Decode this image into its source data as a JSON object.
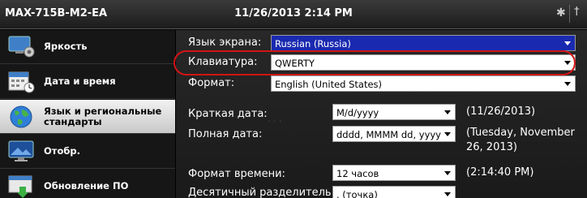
{
  "titlebar": {
    "device": "MAX-715B-M2-EA",
    "datetime": "11/26/2013 2:14 PM"
  },
  "sidebar": {
    "items": [
      {
        "label": "Яркость",
        "icon": "brightness-icon"
      },
      {
        "label": "Дата и время",
        "icon": "calendar-clock-icon"
      },
      {
        "label": "Язык и региональные стандарты",
        "icon": "globe-icon",
        "selected": true
      },
      {
        "label": "Отобр.",
        "icon": "display-icon"
      },
      {
        "label": "Обновление ПО",
        "icon": "software-update-icon"
      }
    ]
  },
  "settings": {
    "display_language": {
      "label": "Язык экрана:",
      "value": "Russian (Russia)"
    },
    "keyboard": {
      "label": "Клавиатура:",
      "value": "QWERTY"
    },
    "format": {
      "label": "Формат:",
      "value": "English (United States)"
    },
    "short_date": {
      "label": "Краткая дата:",
      "value": "M/d/yyyy",
      "preview": "(11/26/2013)"
    },
    "long_date": {
      "label": "Полная дата:",
      "value": "dddd, MMMM dd, yyyy",
      "preview_line1": "(Tuesday, November",
      "preview_line2": "26, 2013)"
    },
    "time_format": {
      "label": "Формат времени:",
      "value": "12 часов",
      "preview": "(2:14:40 PM)"
    },
    "decimal_separator": {
      "label": "Десятичный разделитель:",
      "value": ". (точка)"
    }
  },
  "colors": {
    "highlight": "#1a2ab0",
    "ring": "#d21414"
  }
}
